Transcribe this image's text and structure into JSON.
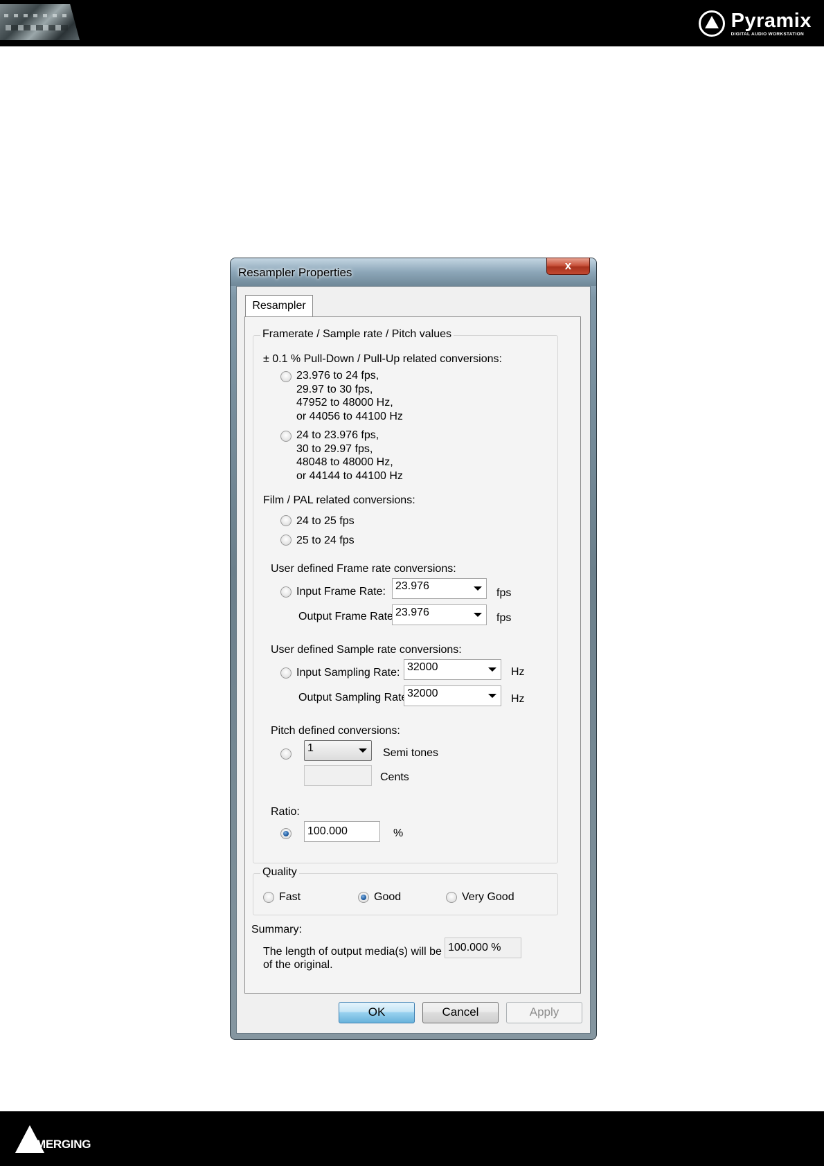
{
  "header": {
    "brand_name": "Pyramix",
    "brand_subtitle": "DIGITAL AUDIO WORKSTATION"
  },
  "footer": {
    "logo_text": "MERGING"
  },
  "dialog": {
    "title": "Resampler Properties",
    "close_label": "x",
    "tab_label": "Resampler",
    "framerate_group": {
      "legend": "Framerate / Sample rate / Pitch values",
      "pulldown_heading": "± 0.1 % Pull-Down / Pull-Up related conversions:",
      "pulldown_option1": "23.976 to 24 fps,\n29.97 to 30 fps,\n47952 to 48000 Hz,\nor 44056 to 44100 Hz",
      "pulldown_option2": "24 to 23.976 fps,\n30 to 29.97 fps,\n48048 to 48000 Hz,\nor 44144 to 44100 Hz",
      "film_pal_heading": "Film / PAL related conversions:",
      "film_option1": "24 to 25 fps",
      "film_option2": "25 to 24 fps",
      "user_frame_heading": "User defined Frame rate conversions:",
      "input_frame_label": "Input Frame Rate:",
      "input_frame_value": "23.976",
      "output_frame_label": "Output Frame Rate:",
      "output_frame_value": "23.976",
      "fps_unit": "fps",
      "user_sample_heading": "User defined Sample rate conversions:",
      "input_sampling_label": "Input Sampling Rate:",
      "input_sampling_value": "32000",
      "output_sampling_label": "Output Sampling Rate:",
      "output_sampling_value": "32000",
      "hz_unit": "Hz",
      "pitch_heading": "Pitch defined conversions:",
      "semitones_value": "1",
      "semitones_label": "Semi tones",
      "cents_value": "",
      "cents_label": "Cents",
      "ratio_heading": "Ratio:",
      "ratio_value": "100.000",
      "percent_unit": "%"
    },
    "quality_group": {
      "legend": "Quality",
      "fast": "Fast",
      "good": "Good",
      "very_good": "Very Good",
      "selected": "Good"
    },
    "summary": {
      "heading": "Summary:",
      "text_line1": "The length of output media(s) will be",
      "text_line2": "of the original.",
      "value": "100.000 %"
    },
    "buttons": {
      "ok": "OK",
      "cancel": "Cancel",
      "apply": "Apply"
    }
  }
}
